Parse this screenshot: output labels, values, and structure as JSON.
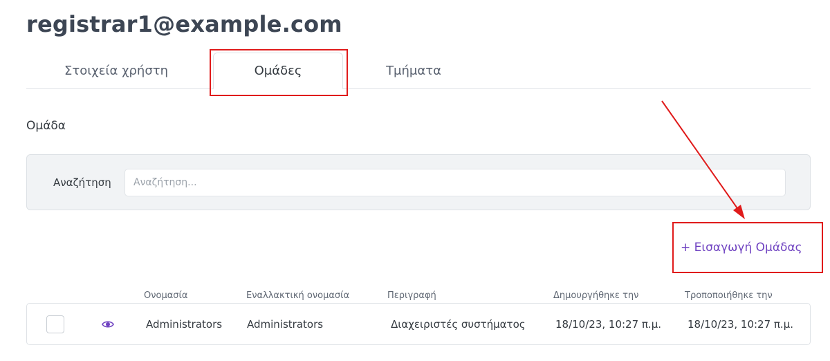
{
  "user": {
    "email": "registrar1@example.com"
  },
  "tabs": [
    {
      "label": "Στοιχεία χρήστη",
      "active": false
    },
    {
      "label": "Ομάδες",
      "active": true
    },
    {
      "label": "Τμήματα",
      "active": false
    }
  ],
  "section": {
    "title": "Ομάδα"
  },
  "search": {
    "label": "Αναζήτηση",
    "placeholder": "Αναζήτηση...",
    "value": ""
  },
  "actions": {
    "add_group": "+ Εισαγωγή Ομάδας"
  },
  "table": {
    "columns": [
      "Ονομασία",
      "Εναλλακτική ονομασία",
      "Περιγραφή",
      "Δημουργήθηκε την",
      "Τροποποιήθηκε την"
    ],
    "rows": [
      {
        "name": "Administrators",
        "alt_name": "Administrators",
        "description": "Διαχειριστές συστήματος",
        "created": "18/10/23, 10:27 π.μ.",
        "modified": "18/10/23, 10:27 π.μ.",
        "checked": false
      }
    ]
  },
  "colors": {
    "accent": "#6f42c1",
    "highlight": "#e01b1b",
    "panel": "#f1f3f5"
  },
  "icons": {
    "view": "eye-icon"
  }
}
